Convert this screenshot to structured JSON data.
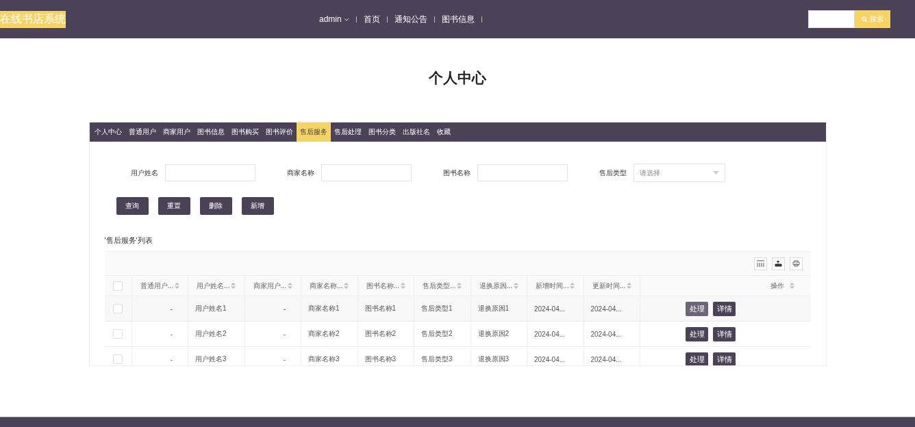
{
  "header": {
    "logo": "在线书店系统",
    "user": "admin",
    "nav": [
      "首页",
      "通知公告",
      "图书信息"
    ],
    "search_button": "搜索"
  },
  "page_title": "个人中心",
  "tabs": [
    {
      "label": "个人中心",
      "selected": false
    },
    {
      "label": "普通用户",
      "selected": false
    },
    {
      "label": "商家用户",
      "selected": false
    },
    {
      "label": "图书信息",
      "selected": false
    },
    {
      "label": "图书购买",
      "selected": false
    },
    {
      "label": "图书评价",
      "selected": false
    },
    {
      "label": "售后服务",
      "selected": true
    },
    {
      "label": "售后处理",
      "selected": false
    },
    {
      "label": "图书分类",
      "selected": false
    },
    {
      "label": "出版社名",
      "selected": false
    },
    {
      "label": "收藏",
      "selected": false
    }
  ],
  "filters": [
    {
      "kind": "text",
      "label": "用户姓名"
    },
    {
      "kind": "text",
      "label": "商家名称"
    },
    {
      "kind": "text",
      "label": "图书名称"
    },
    {
      "kind": "select",
      "label": "售后类型",
      "placeholder": "请选择"
    }
  ],
  "buttons": [
    "查询",
    "重置",
    "删除",
    "新增"
  ],
  "list_title": "'售后服务'列表",
  "table": {
    "all_checked": false,
    "columns": [
      "普通用户...",
      "用户姓名...",
      "商家用户...",
      "商家名称...",
      "图书名称...",
      "售后类型...",
      "退换原因...",
      "新增时间...",
      "更新时间...",
      "操作"
    ],
    "rows": [
      {
        "hovered": true,
        "checked": false,
        "cells": [
          "-",
          "用户姓名1",
          "-",
          "商家名称1",
          "图书名称1",
          "售后类型1",
          "退换原因1",
          "2024-04...",
          "2024-04..."
        ],
        "actions": [
          "处理",
          "详情"
        ]
      },
      {
        "hovered": false,
        "checked": false,
        "cells": [
          "-",
          "用户姓名2",
          "-",
          "商家名称2",
          "图书名称2",
          "售后类型2",
          "退换原因2",
          "2024-04...",
          "2024-04..."
        ],
        "actions": [
          "处理",
          "详情"
        ]
      },
      {
        "hovered": false,
        "checked": false,
        "cells": [
          "-",
          "用户姓名3",
          "-",
          "商家名称3",
          "图书名称3",
          "售后类型3",
          "退换原因3",
          "2024-04...",
          "2024-04..."
        ],
        "actions": [
          "处理",
          "详情"
        ]
      }
    ]
  }
}
